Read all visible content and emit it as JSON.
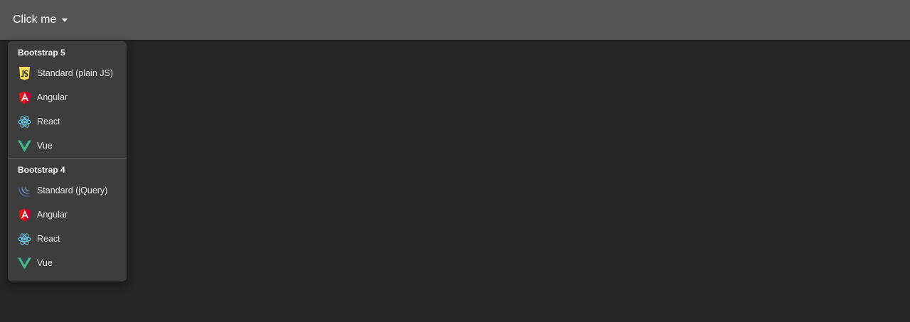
{
  "navbar": {
    "toggle_label": "Click me"
  },
  "menu": {
    "groups": [
      {
        "header": "Bootstrap 5",
        "items": [
          {
            "label": "Standard (plain JS)",
            "icon": "javascript-icon"
          },
          {
            "label": "Angular",
            "icon": "angular-icon"
          },
          {
            "label": "React",
            "icon": "react-icon"
          },
          {
            "label": "Vue",
            "icon": "vue-icon"
          }
        ]
      },
      {
        "header": "Bootstrap 4",
        "items": [
          {
            "label": "Standard (jQuery)",
            "icon": "jquery-icon"
          },
          {
            "label": "Angular",
            "icon": "angular-icon"
          },
          {
            "label": "React",
            "icon": "react-icon"
          },
          {
            "label": "Vue",
            "icon": "vue-icon"
          }
        ]
      }
    ]
  },
  "colors": {
    "background": "#262626",
    "navbar": "#545454",
    "menu": "#3d3d3d",
    "javascript": "#f0db4f",
    "angular": "#dd1b16",
    "react": "#61dafb",
    "vue": "#41b883",
    "jquery": "#4a6ea9"
  }
}
